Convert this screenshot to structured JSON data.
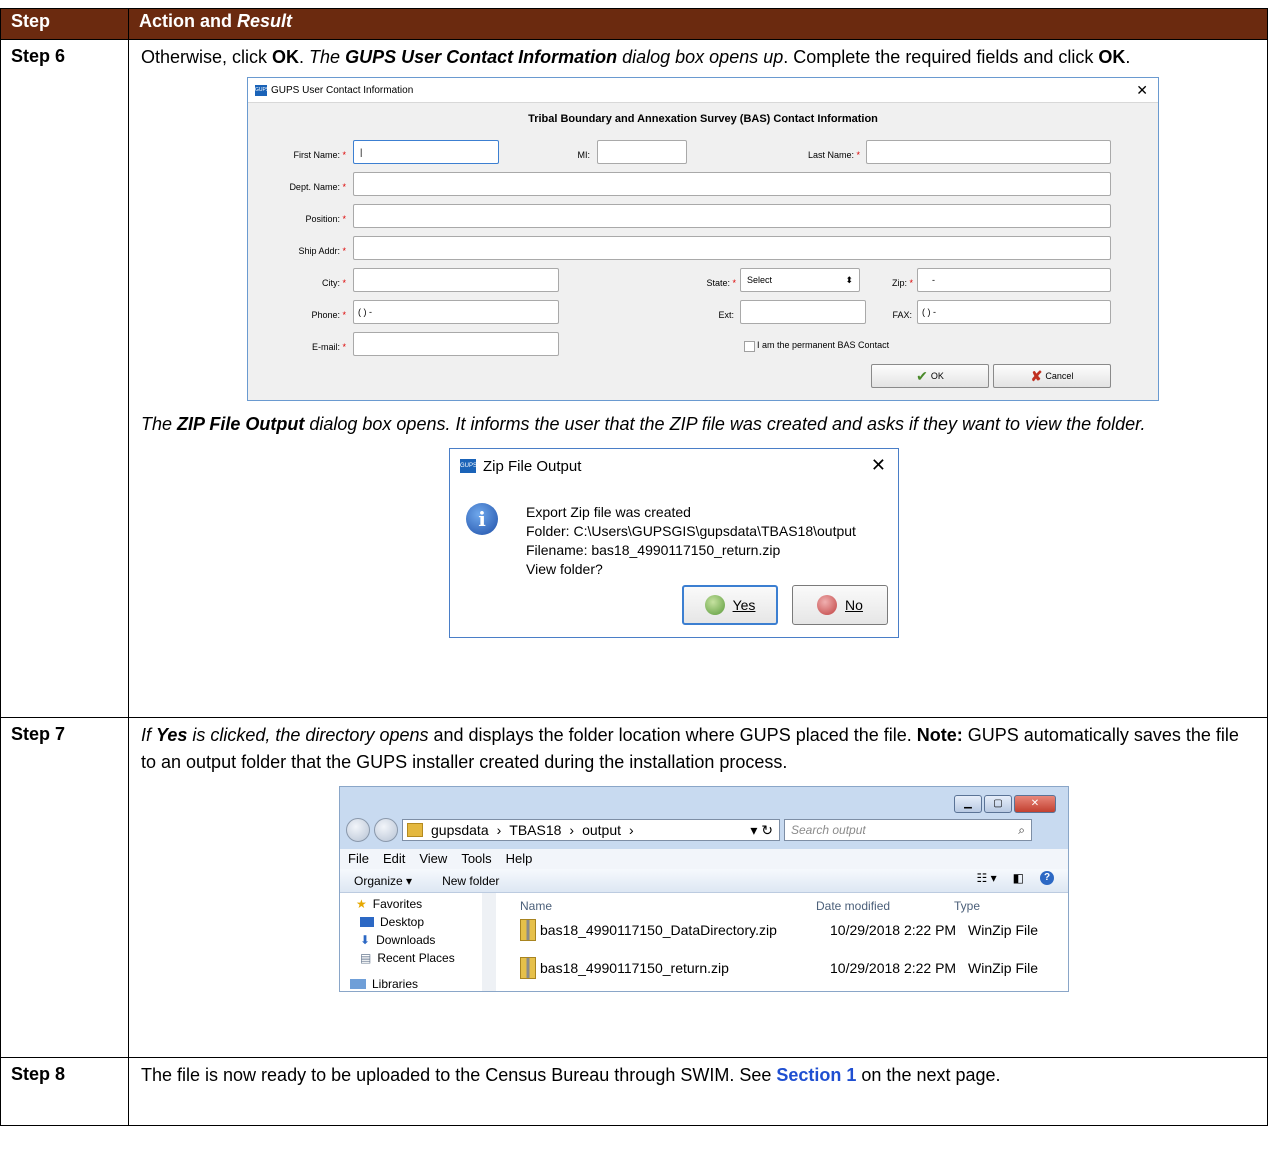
{
  "table": {
    "header": {
      "step": "Step",
      "action": "Action and ",
      "result": "Result"
    },
    "rows": [
      {
        "step": "Step 6",
        "text": {
          "p1_a": "Otherwise, click ",
          "p1_ok": "OK",
          "p1_b": ". ",
          "p1_c": "The ",
          "p1_d": "GUPS User Contact Information",
          "p1_e": " dialog box opens up",
          "p1_f": ". Complete the required fields and click ",
          "p1_ok2": "OK",
          "p1_g": ".",
          "p2_a": "The ",
          "p2_b": "ZIP File Output",
          "p2_c": " dialog box opens. It informs the user that the ZIP file was created and asks if they want to view the folder."
        }
      },
      {
        "step": "Step 7",
        "text": {
          "a": "If ",
          "b": "Yes",
          "c": " is clicked, the directory opens",
          "d": " and displays the folder location where GUPS placed the file. ",
          "note": "Note:",
          "e": " GUPS automatically saves the file to an output folder that the GUPS installer created during the installation process."
        }
      },
      {
        "step": "Step 8",
        "text": {
          "a": "The file is now ready to be uploaded to the Census Bureau through SWIM. See ",
          "link": "Section 1",
          "b": " on the next page."
        }
      }
    ]
  },
  "gups_dialog": {
    "title": "GUPS User Contact Information",
    "icon_text": "GUPS",
    "heading": "Tribal Boundary and Annexation Survey (BAS) Contact Information",
    "labels": {
      "first": "First Name:",
      "mi": "MI:",
      "last": "Last Name:",
      "dept": "Dept. Name:",
      "position": "Position:",
      "ship": "Ship Addr:",
      "city": "City:",
      "state": "State:",
      "zip": "Zip:",
      "phone": "Phone:",
      "ext": "Ext:",
      "fax": "FAX:",
      "email": "E-mail:"
    },
    "required_mark": "*",
    "values": {
      "first": "|",
      "state": "Select",
      "zip": "-",
      "phone": "(  )   -",
      "fax": "(  )   -"
    },
    "checkbox_label": "I am the permanent BAS Contact",
    "ok": "OK",
    "cancel": "Cancel"
  },
  "zip_dialog": {
    "title": "Zip File Output",
    "icon_text": "GUPS",
    "lines": [
      "Export Zip file was created",
      "Folder: C:\\Users\\GUPSGIS\\gupsdata\\TBAS18\\output",
      "Filename: bas18_4990117150_return.zip",
      "View folder?"
    ],
    "yes": "Yes",
    "no": "No"
  },
  "explorer": {
    "breadcrumb": [
      "gupsdata",
      "TBAS18",
      "output"
    ],
    "search_placeholder": "Search output",
    "menu": [
      "File",
      "Edit",
      "View",
      "Tools",
      "Help"
    ],
    "commands": [
      "Organize ▾",
      "New folder"
    ],
    "nav": [
      "Favorites",
      "Desktop",
      "Downloads",
      "Recent Places",
      "Libraries"
    ],
    "columns": [
      "Name",
      "Date modified",
      "Type"
    ],
    "files": [
      {
        "name": "bas18_4990117150_DataDirectory.zip",
        "date": "10/29/2018 2:22 PM",
        "type": "WinZip File"
      },
      {
        "name": "bas18_4990117150_return.zip",
        "date": "10/29/2018 2:22 PM",
        "type": "WinZip File"
      }
    ]
  }
}
